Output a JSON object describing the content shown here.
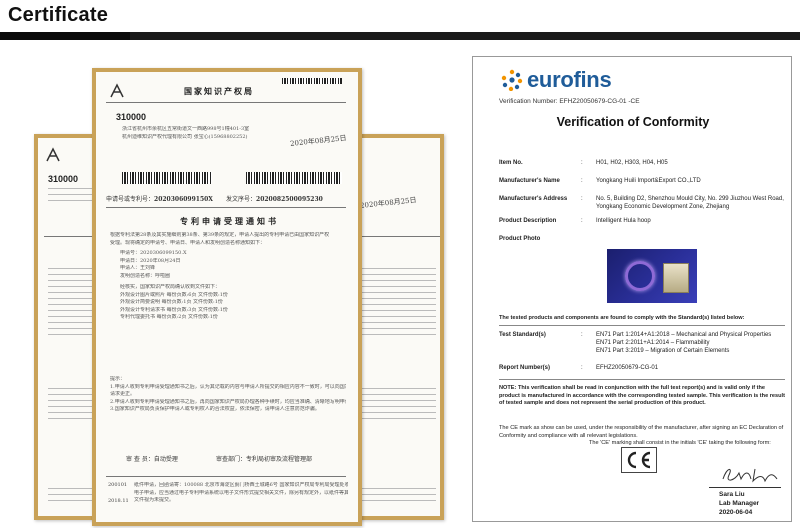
{
  "page": {
    "title": "Certificate"
  },
  "cn_cert": {
    "office_name": "国家知识产权局",
    "postal_code": "310000",
    "address_lines": [
      "浙江省杭州市余杭区五常街道文一西路998号1幢401-3室",
      "杭州迪维知识产权代理有限公司 张宝心(15968802252)"
    ],
    "issue_date": "2020年08月25日",
    "app_number_label": "申请号或专利号：",
    "app_number": "2020306099150X",
    "doc_number_label": "发文序号：",
    "doc_number": "2020082500095230",
    "notice_title": "专利申请受理通知书",
    "body_lines": [
      "根据专利法第28条及其实施细则第38条、第39条的规定，申请人提出的专利申请已由国家知识产权",
      "受理。现将确定的申请号、申请日、申请人和发明创造名称通知如下："
    ],
    "detail_lines": [
      "申请号：2020306099150.X",
      "申请日：2020年08月24日",
      "申请人：王刘锋",
      "发明创造名称：呼啦圈"
    ],
    "files_intro": "经核实，国家知识产权局确认收到文件如下：",
    "file_lines": [
      "外观设计图片或照片 每份页数:6页 文件份数:1份",
      "外观设计简要说明 每份页数:1页 文件份数:1份",
      "外观设计专利请求书 每份页数:3页 文件份数:1份",
      "专利代理委托书 每份页数:2页 文件份数:1份"
    ],
    "notes_heading": "提示：",
    "note_lines": [
      "1.申请人收到专利申请受理通知书之后，认为其记载的内容与申请人所提交的相应内容不一致时，可以向国家知识产权局",
      "请求更正。",
      "2.申请人收到专利申请受理通知书之后，再向国家知识产权局办理各种手续时，均应当准确、清晰地写明申请号。",
      "3.国家知识产权局负责保护申请人或专利权人的合法权益，依法保密，请申请人注意防范诈骗。"
    ],
    "reviewer_label": "审 查 员：自动受理",
    "review_dept_label": "审查部门：专利局初审及流程管理部",
    "footer_code_1": "200101",
    "footer_code_2": "2018.11",
    "footer_lines": [
      "纸件申请，回函请寄：100088 北京市海淀区蓟门桥西土城路6号 国家知识产权局专利局受理处收",
      "电子申请，应当通过电子专利申请系统以电子文件形式提交相关文件，除另有规定外，以纸件等其他形式提交的",
      "文件视为未提交。"
    ],
    "back_left_postal": "310000",
    "back_right_date": "2020年08月25日"
  },
  "eurofins": {
    "logo_text": "eurofins",
    "verification_number": "Verification Number: EFHZ20050679-CG-01 -CE",
    "title": "Verification of Conformity",
    "rows": [
      {
        "label": "Item No.",
        "colon": ":",
        "value": "H01, H02, H303, H04, H05"
      },
      {
        "label": "Manufacturer's Name",
        "colon": ":",
        "value": "Yongkang Huili Import&Export CO.,LTD"
      },
      {
        "label": "Manufacturer's Address",
        "colon": ":",
        "value": "No. 5, Building D2, Shenzhou Mould City, No. 299 Jiuzhou West Road, Yongkang Economic Development Zone, Zhejiang"
      },
      {
        "label": "Product Description",
        "colon": ":",
        "value": "Intelligent Hula hoop"
      },
      {
        "label": "Product Photo",
        "colon": ":",
        "value": ""
      }
    ],
    "tested_statement": "The tested products and components are found to comply with the Standard(s) listed below:",
    "test_standards_label": "Test Standard(s)",
    "test_standards_colon": ":",
    "test_standards": [
      "EN71 Part 1:2014+A1:2018 – Mechanical and Physical Properties",
      "EN71 Part 2:2011+A1:2014 – Flammability",
      "EN71 Part 3:2019 – Migration of Certain Elements"
    ],
    "report_label": "Report Number(s)",
    "report_colon": ":",
    "report_value": "EFHZ20050679-CG-01",
    "note_bold": "NOTE: This verification shall be read in conjunction with the full test report(s) and is valid only if the product is manufactured in accordance with the corresponding tested sample. This verification is the result of tested sample and does not represent the serial production of this product.",
    "ce_text_1": "The CE mark as show can be used, under the responsibility of the manufacturer, after signing an EC Declaration of Conformity and compliance with all relevant legislations.",
    "ce_text_2": "The 'CE' marking shall consist in the initials 'CE' taking the following form:",
    "signatory_name": "Sara Liu",
    "signatory_role": "Lab Manager",
    "signatory_date": "2020-06-04"
  },
  "colors": {
    "cert_frame": "#c9a258",
    "eurofins_blue": "#1f5c99",
    "header_bar": "#1a1a1a"
  },
  "icons": [
    "patent-office-logo-icon",
    "barcode-icon",
    "eurofins-logo-icon",
    "ce-mark-icon",
    "signature-icon"
  ]
}
